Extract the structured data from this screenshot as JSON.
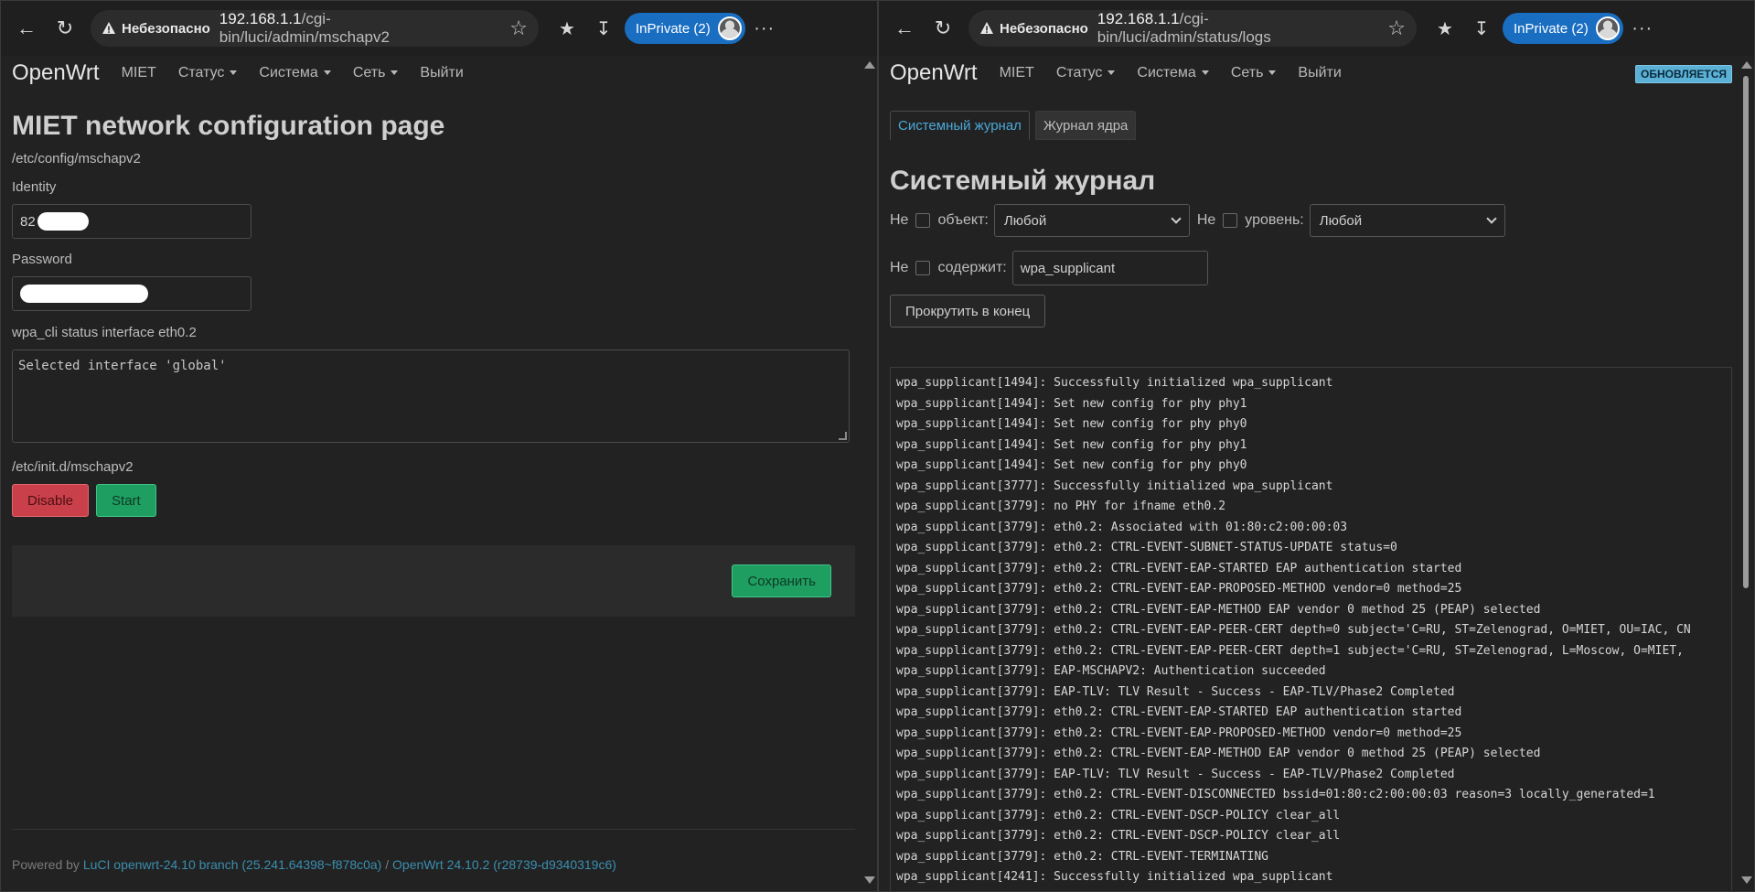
{
  "left": {
    "browser": {
      "insecure_label": "Небезопасно",
      "url_host": "192.168.1.1",
      "url_path": "/cgi-bin/luci/admin/mschapv2",
      "inprivate_label": "InPrivate (2)"
    },
    "nav": {
      "brand": "OpenWrt",
      "items": [
        "MIET",
        "Статус",
        "Система",
        "Сеть",
        "Выйти"
      ]
    },
    "page_title": "MIET network configuration page",
    "config_path": "/etc/config/mschapv2",
    "identity": {
      "label": "Identity",
      "value": "82"
    },
    "password": {
      "label": "Password"
    },
    "status": {
      "label": "wpa_cli status interface eth0.2",
      "output": "Selected interface 'global'"
    },
    "init_path": "/etc/init.d/mschapv2",
    "buttons": {
      "disable": "Disable",
      "start": "Start",
      "save": "Сохранить"
    },
    "footer": {
      "prefix": "Powered by ",
      "luci": "LuCI openwrt-24.10 branch (25.241.64398~f878c0a)",
      "sep": " / ",
      "openwrt": "OpenWrt 24.10.2 (r28739-d9340319c6)"
    }
  },
  "right": {
    "browser": {
      "insecure_label": "Небезопасно",
      "url_host": "192.168.1.1",
      "url_path": "/cgi-bin/luci/admin/status/logs",
      "inprivate_label": "InPrivate (2)"
    },
    "nav": {
      "brand": "OpenWrt",
      "items": [
        "MIET",
        "Статус",
        "Система",
        "Сеть",
        "Выйти"
      ],
      "refresh_badge": "ОБНОВЛЯЕТСЯ"
    },
    "tabs": [
      "Системный журнал",
      "Журнал ядра"
    ],
    "page_title": "Системный журнал",
    "filters": {
      "not_label": "Не",
      "object_label": "объект:",
      "object_value": "Любой",
      "level_label": "уровень:",
      "level_value": "Любой",
      "contains_label": "содержит:",
      "contains_value": "wpa_supplicant"
    },
    "scroll_button": "Прокрутить в конец",
    "log_lines": [
      "wpa_supplicant[1494]: Successfully initialized wpa_supplicant",
      "wpa_supplicant[1494]: Set new config for phy phy1",
      "wpa_supplicant[1494]: Set new config for phy phy0",
      "wpa_supplicant[1494]: Set new config for phy phy1",
      "wpa_supplicant[1494]: Set new config for phy phy0",
      "wpa_supplicant[3777]: Successfully initialized wpa_supplicant",
      "wpa_supplicant[3779]: no PHY for ifname eth0.2",
      "wpa_supplicant[3779]: eth0.2: Associated with 01:80:c2:00:00:03",
      "wpa_supplicant[3779]: eth0.2: CTRL-EVENT-SUBNET-STATUS-UPDATE status=0",
      "wpa_supplicant[3779]: eth0.2: CTRL-EVENT-EAP-STARTED EAP authentication started",
      "wpa_supplicant[3779]: eth0.2: CTRL-EVENT-EAP-PROPOSED-METHOD vendor=0 method=25",
      "wpa_supplicant[3779]: eth0.2: CTRL-EVENT-EAP-METHOD EAP vendor 0 method 25 (PEAP) selected",
      "wpa_supplicant[3779]: eth0.2: CTRL-EVENT-EAP-PEER-CERT depth=0 subject='C=RU, ST=Zelenograd, O=MIET, OU=IAC, CN",
      "wpa_supplicant[3779]: eth0.2: CTRL-EVENT-EAP-PEER-CERT depth=1 subject='C=RU, ST=Zelenograd, L=Moscow, O=MIET, ",
      "wpa_supplicant[3779]: EAP-MSCHAPV2: Authentication succeeded",
      "wpa_supplicant[3779]: EAP-TLV: TLV Result - Success - EAP-TLV/Phase2 Completed",
      "wpa_supplicant[3779]: eth0.2: CTRL-EVENT-EAP-STARTED EAP authentication started",
      "wpa_supplicant[3779]: eth0.2: CTRL-EVENT-EAP-PROPOSED-METHOD vendor=0 method=25",
      "wpa_supplicant[3779]: eth0.2: CTRL-EVENT-EAP-METHOD EAP vendor 0 method 25 (PEAP) selected",
      "wpa_supplicant[3779]: EAP-TLV: TLV Result - Success - EAP-TLV/Phase2 Completed",
      "wpa_supplicant[3779]: eth0.2: CTRL-EVENT-DISCONNECTED bssid=01:80:c2:00:00:03 reason=3 locally_generated=1",
      "wpa_supplicant[3779]: eth0.2: CTRL-EVENT-DSCP-POLICY clear_all",
      "wpa_supplicant[3779]: eth0.2: CTRL-EVENT-DSCP-POLICY clear_all",
      "wpa_supplicant[3779]: eth0.2: CTRL-EVENT-TERMINATING",
      "wpa_supplicant[4241]: Successfully initialized wpa_supplicant"
    ]
  },
  "icons": {
    "back": "back-arrow-icon",
    "refresh": "refresh-icon",
    "warning": "warning-triangle-icon",
    "favorite": "star-icon",
    "favorites": "favorites-icon",
    "download": "download-icon",
    "menu": "more-icon"
  },
  "colors": {
    "accent_blue": "#1a6ec2",
    "danger": "#c9404a",
    "success": "#1f9e62",
    "link": "#3a8fb0",
    "active_tab": "#4aa8d8"
  }
}
